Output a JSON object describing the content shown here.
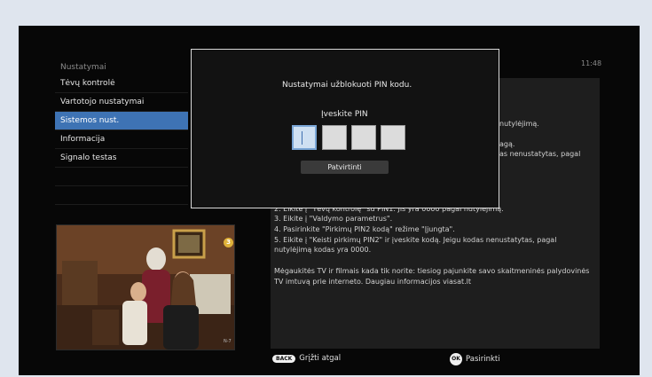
{
  "header": {
    "title": "Nustatymai",
    "clock": "11:48"
  },
  "menu": {
    "items": [
      {
        "label": "Tėvų kontrolė"
      },
      {
        "label": "Vartotojo nustatymai"
      },
      {
        "label": "Sistemos nust.",
        "active": true
      },
      {
        "label": "Informacija"
      },
      {
        "label": "Signalo testas"
      }
    ]
  },
  "info": {
    "fragments": [
      "nutylėjimą.",
      "agą.",
      "as nenustatytas, pagal"
    ],
    "lines": [
      "2. Eikite į \"Tėvų kontrolę\" su PIN1. Jis yra 0000 pagal nutylėjimą.",
      "3. Eikite į \"Valdymo parametrus\".",
      "4. Pasirinkite \"Pirkimų PIN2 kodą\" režime \"Įjungta\".",
      "5. Eikite į \"Keisti pirkimų PIN2\" ir įveskite kodą. Jeigu kodas nenustatytas, pagal",
      "nutylėjimą kodas yra 0000.",
      "",
      "Mėgaukitės TV ir filmais kada tik norite: tiesiog pajunkite savo skaitmeninės palydovinės",
      "TV imtuvą prie interneto. Daugiau informacijos  viasat.lt"
    ]
  },
  "dialog": {
    "title": "Nustatymai užblokuoti PIN kodu.",
    "pin_label": "Įveskite PIN",
    "confirm_label": "Patvirtinti"
  },
  "preview": {
    "channel_badge": "3",
    "watermark": "N-7"
  },
  "footer": {
    "back_key": "BACK",
    "back_label": "Grįžti atgal",
    "ok_key": "OK",
    "ok_label": "Pasirinkti"
  },
  "colors": {
    "accent": "#3e73b4",
    "panel": "#1e1e1e",
    "background": "#070707"
  }
}
